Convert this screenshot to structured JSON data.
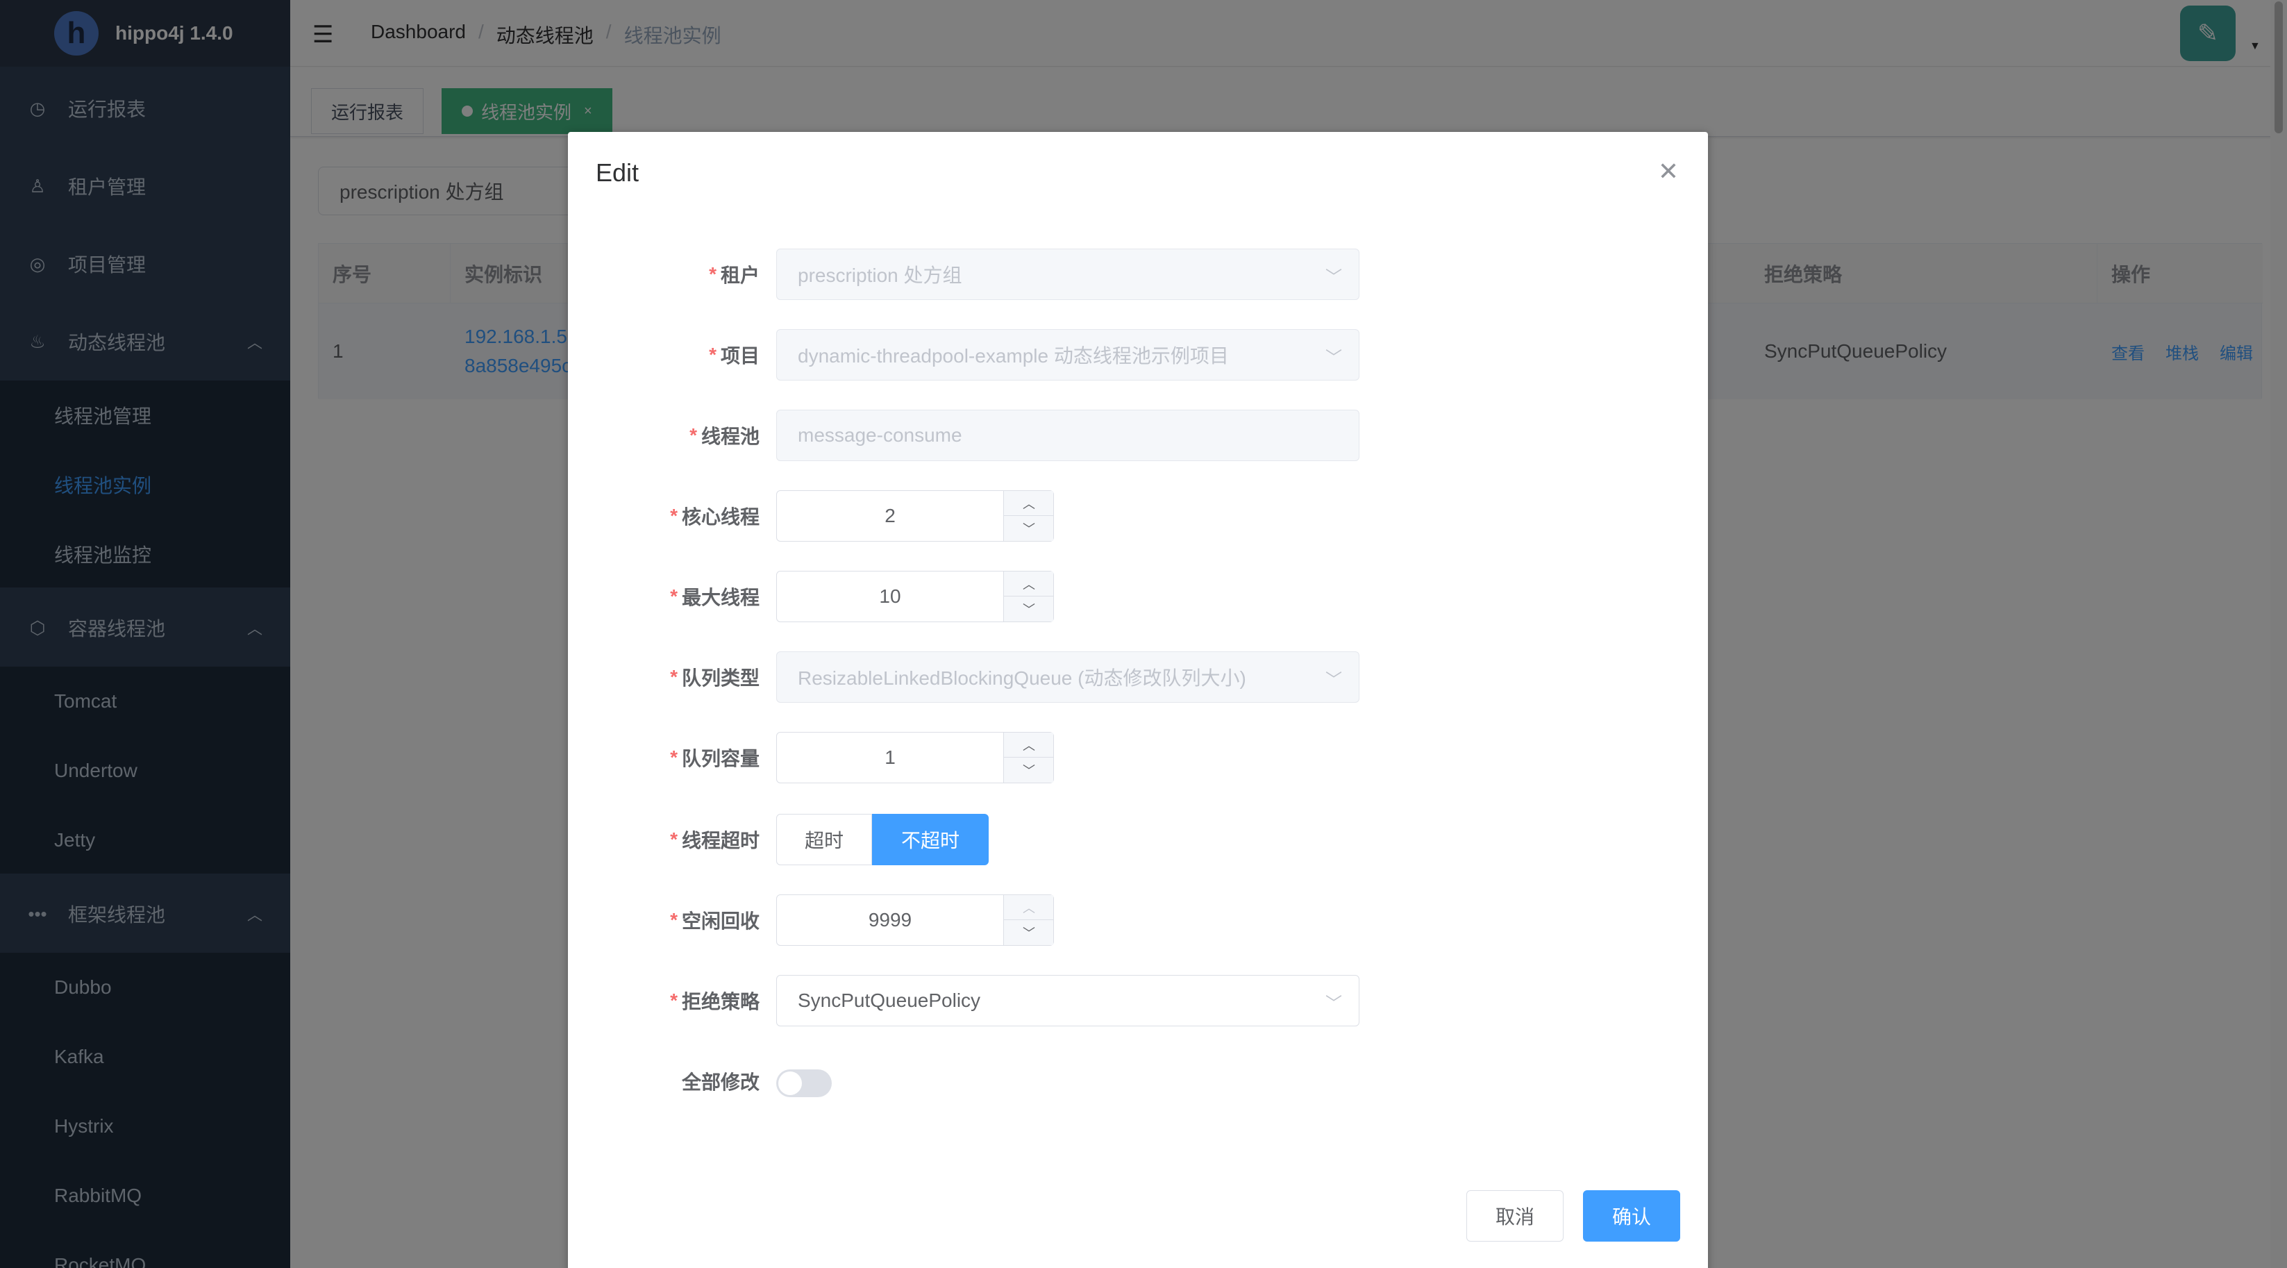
{
  "app": {
    "title": "hippo4j 1.4.0",
    "logo_letter": "h"
  },
  "sidebar": {
    "items": [
      {
        "label": "运行报表",
        "icon": "dashboard-icon"
      },
      {
        "label": "租户管理",
        "icon": "user-icon"
      },
      {
        "label": "项目管理",
        "icon": "project-icon"
      },
      {
        "label": "动态线程池",
        "icon": "threadpool-icon",
        "children": [
          "线程池管理",
          "线程池实例",
          "线程池监控"
        ],
        "active_child": "线程池实例"
      },
      {
        "label": "容器线程池",
        "icon": "container-icon",
        "children": [
          "Tomcat",
          "Undertow",
          "Jetty"
        ]
      },
      {
        "label": "框架线程池",
        "icon": "framework-icon",
        "children": [
          "Dubbo",
          "Kafka",
          "Hystrix",
          "RabbitMQ",
          "RocketMQ"
        ]
      }
    ]
  },
  "header": {
    "breadcrumb": [
      "Dashboard",
      "动态线程池",
      "线程池实例"
    ],
    "separator": "/"
  },
  "tags": [
    {
      "label": "运行报表",
      "active": false
    },
    {
      "label": "线程池实例",
      "active": true
    }
  ],
  "filter": {
    "tenant_value": "prescription 处方组"
  },
  "table": {
    "headers": [
      "序号",
      "实例标识",
      "拒绝策略",
      "操作"
    ],
    "rows": [
      {
        "index": "1",
        "instance_line1": "192.168.1.5",
        "instance_line2": "8a858e495c",
        "policy": "SyncPutQueuePolicy",
        "ops": [
          "查看",
          "堆栈",
          "编辑"
        ]
      }
    ]
  },
  "dialog": {
    "title": "Edit",
    "fields": {
      "tenant": {
        "label": "租户",
        "value": "prescription 处方组"
      },
      "project": {
        "label": "项目",
        "value": "dynamic-threadpool-example 动态线程池示例项目"
      },
      "threadpool": {
        "label": "线程池",
        "value": "message-consume"
      },
      "core_threads": {
        "label": "核心线程",
        "value": "2"
      },
      "max_threads": {
        "label": "最大线程",
        "value": "10"
      },
      "queue_type": {
        "label": "队列类型",
        "value": "ResizableLinkedBlockingQueue (动态修改队列大小)"
      },
      "queue_capacity": {
        "label": "队列容量",
        "value": "1"
      },
      "thread_timeout": {
        "label": "线程超时",
        "options": [
          "超时",
          "不超时"
        ],
        "selected": "不超时"
      },
      "keep_alive": {
        "label": "空闲回收",
        "value": "9999"
      },
      "reject_policy": {
        "label": "拒绝策略",
        "value": "SyncPutQueuePolicy"
      },
      "modify_all": {
        "label": "全部修改",
        "on": false
      }
    },
    "buttons": {
      "cancel": "取消",
      "confirm": "确认"
    }
  },
  "colors": {
    "primary": "#409eff",
    "sidebar_bg": "#304156",
    "active_tag": "#42b983",
    "required_star": "#f56c6c"
  }
}
